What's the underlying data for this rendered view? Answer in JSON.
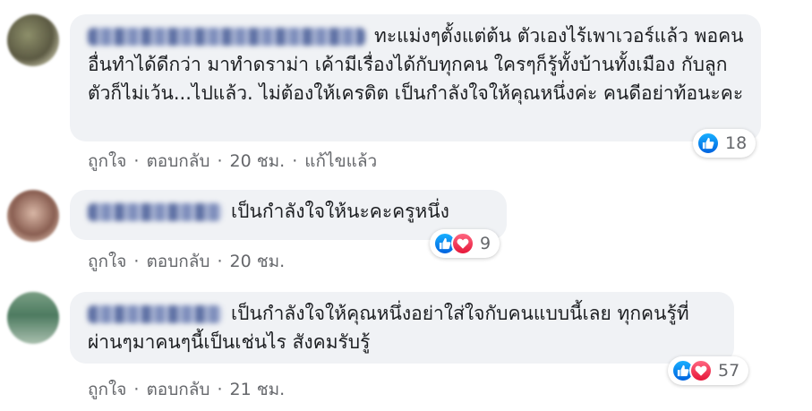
{
  "comments": [
    {
      "text": "ทะแม่งๆตั้งแต่ต้น ตัวเองไร้เพาเวอร์แล้ว พอคนอื่นทำได้ดีกว่า มาทำดราม่า เค้ามีเรื่องได้กับทุกคน ใครๆก็รู้ทั้งบ้านทั้งเมือง กับลูกตัวก็ไม่เว้น...ไปแล้ว. ไม่ต้องให้เครดิต เป็นกำลังใจให้คุณหนึ่งค่ะ คนดีอย่าท้อนะคะ",
      "reaction_count": "18",
      "reactions": [
        "like-icon"
      ],
      "actions": {
        "like": "ถูกใจ",
        "reply": "ตอบกลับ",
        "time": "20 ชม.",
        "edited": "แก้ไขแล้ว"
      }
    },
    {
      "text": "เป็นกำลังใจให้นะคะครูหนึ่ง",
      "reaction_count": "9",
      "reactions": [
        "like-icon",
        "love-icon"
      ],
      "actions": {
        "like": "ถูกใจ",
        "reply": "ตอบกลับ",
        "time": "20 ชม."
      }
    },
    {
      "text": "เป็นกำลังใจให้คุณหนึ่งอย่าใส่ใจกับคนแบบนี้เลย ทุกคนรู้ที่ผ่านๆมาคนๆนี้เป็นเช่นไร สังคมรับรู้",
      "reaction_count": "57",
      "reactions": [
        "like-icon",
        "love-icon"
      ],
      "actions": {
        "like": "ถูกใจ",
        "reply": "ตอบกลับ",
        "time": "21 ชม."
      }
    }
  ],
  "separator": "·",
  "colors": {
    "bubble": "#f0f2f5",
    "meta": "#65676b",
    "like": "#0062df",
    "love": "#e61739"
  }
}
